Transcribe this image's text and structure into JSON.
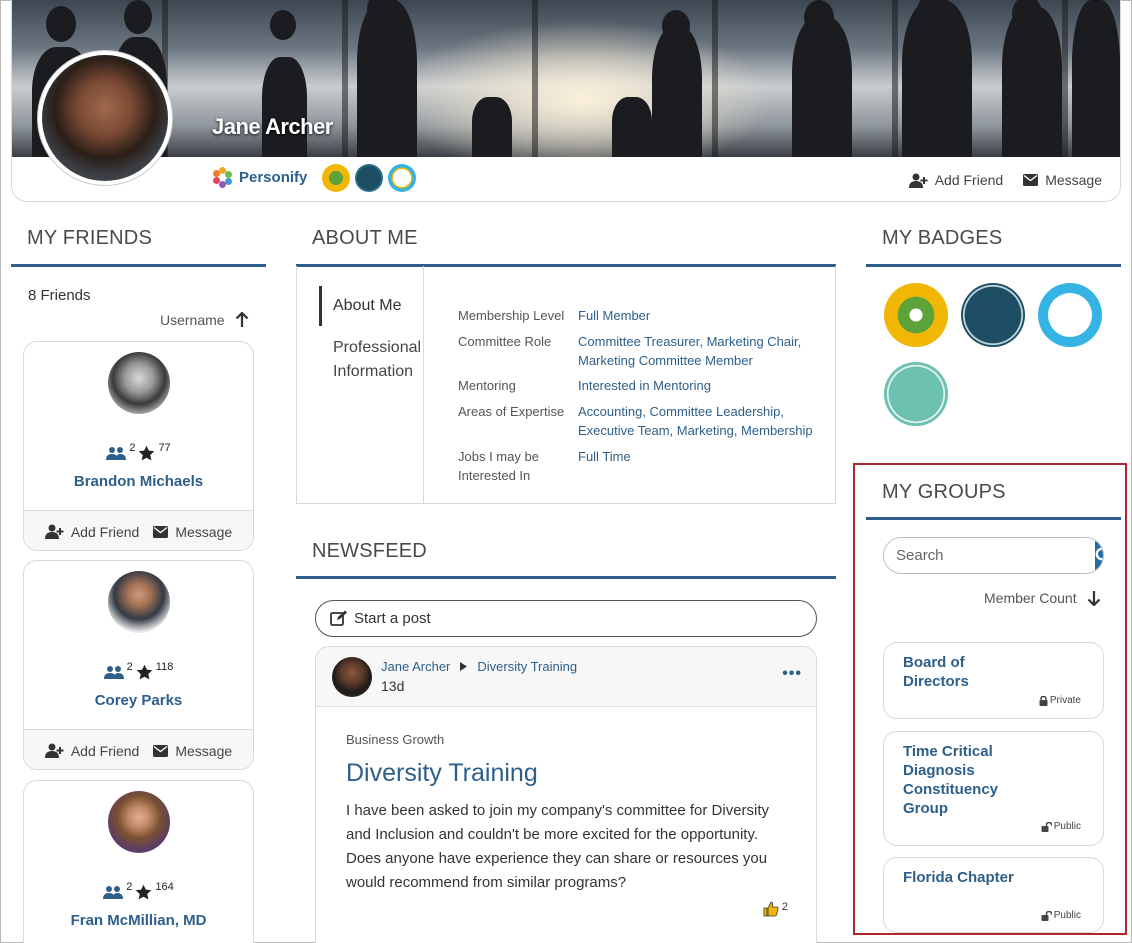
{
  "profile": {
    "name": "Jane Archer",
    "organization": "Personify",
    "actions": {
      "add_friend": "Add Friend",
      "message": "Message"
    }
  },
  "friends": {
    "title": "MY FRIENDS",
    "count_text": "8 Friends",
    "sort_label": "Username",
    "items": [
      {
        "name": "Brandon Michaels",
        "friends": "2",
        "points": "77",
        "add_friend": "Add Friend",
        "message": "Message"
      },
      {
        "name": "Corey Parks",
        "friends": "2",
        "points": "118",
        "add_friend": "Add Friend",
        "message": "Message"
      },
      {
        "name": "Fran McMillian, MD",
        "friends": "2",
        "points": "164",
        "add_friend": "Add Friend",
        "message": "Message"
      }
    ]
  },
  "about": {
    "title": "ABOUT ME",
    "tabs": [
      "About Me",
      "Professional Information"
    ],
    "rows": [
      {
        "label": "Membership Level",
        "value": "Full Member"
      },
      {
        "label": "Committee Role",
        "value": "Committee Treasurer, Marketing Chair, Marketing Committee Member"
      },
      {
        "label": "Mentoring",
        "value": "Interested in Mentoring"
      },
      {
        "label": "Areas of Expertise",
        "value": "Accounting, Committee Leadership, Executive Team, Marketing, Membership"
      },
      {
        "label": "Jobs I may be Interested In",
        "value": "Full Time"
      }
    ]
  },
  "newsfeed": {
    "title": "NEWSFEED",
    "start_post": "Start a post",
    "post": {
      "author": "Jane Archer",
      "group": "Diversity Training",
      "time": "13d",
      "category": "Business Growth",
      "title": "Diversity Training",
      "body": "I have been asked to join my company's committee for Diversity and Inclusion and couldn't be more excited for the opportunity. Does anyone have experience they can share or resources you would recommend from similar programs?",
      "likes": "2"
    }
  },
  "badges": {
    "title": "MY BADGES",
    "items": [
      {
        "icon": "gear-wrench-badge",
        "color": "#f2b705"
      },
      {
        "icon": "member-badge",
        "color": "#1d4e63"
      },
      {
        "icon": "graduation-badge",
        "color": "#34b3e4"
      },
      {
        "icon": "annual-meeting-attendee-badge",
        "color": "#6cc0b0"
      }
    ]
  },
  "groups": {
    "title": "MY GROUPS",
    "search_placeholder": "Search",
    "sort_label": "Member Count",
    "items": [
      {
        "name": "Board of Directors",
        "privacy": "Private"
      },
      {
        "name": "Time Critical Diagnosis Constituency Group",
        "privacy": "Public"
      },
      {
        "name": "Florida Chapter",
        "privacy": "Public"
      }
    ]
  },
  "colors": {
    "accent": "#2d5f8a",
    "highlight": "#b0262e",
    "search_button": "#1e6fa8"
  }
}
